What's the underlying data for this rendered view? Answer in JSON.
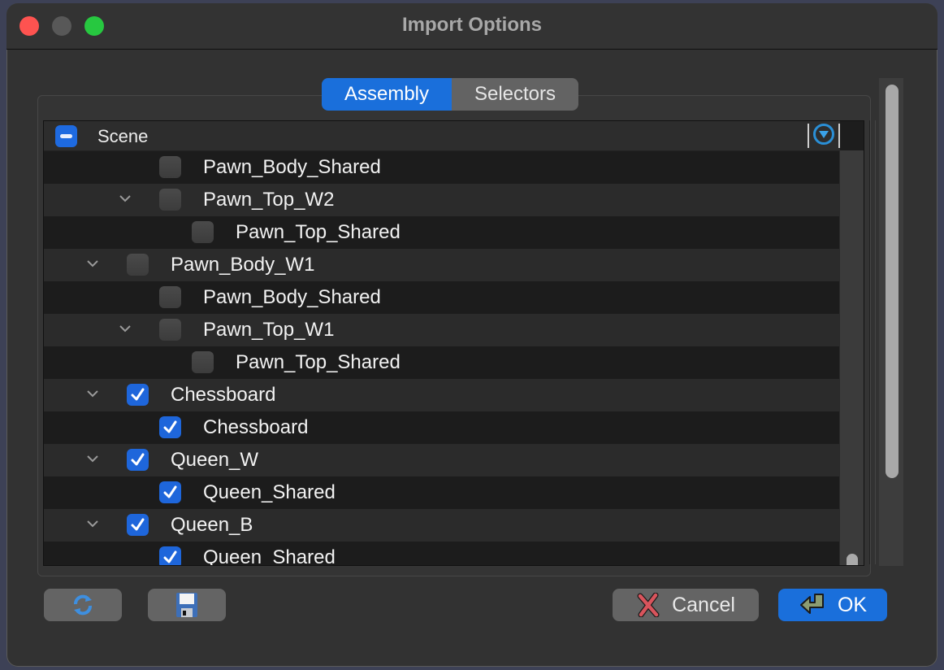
{
  "window": {
    "title": "Import Options"
  },
  "tabs": [
    {
      "label": "Assembly",
      "active": true
    },
    {
      "label": "Selectors",
      "active": false
    }
  ],
  "tree": {
    "header": {
      "label": "Scene",
      "checkbox_state": "partial",
      "menu_icon": "dropdown-circle-icon"
    },
    "rows": [
      {
        "label": "Pawn_Body_Shared",
        "depth": 2,
        "expandable": false,
        "checked": false
      },
      {
        "label": "Pawn_Top_W2",
        "depth": 2,
        "expandable": true,
        "checked": false
      },
      {
        "label": "Pawn_Top_Shared",
        "depth": 3,
        "expandable": false,
        "checked": false
      },
      {
        "label": "Pawn_Body_W1",
        "depth": 1,
        "expandable": true,
        "checked": false
      },
      {
        "label": "Pawn_Body_Shared",
        "depth": 2,
        "expandable": false,
        "checked": false
      },
      {
        "label": "Pawn_Top_W1",
        "depth": 2,
        "expandable": true,
        "checked": false
      },
      {
        "label": "Pawn_Top_Shared",
        "depth": 3,
        "expandable": false,
        "checked": false
      },
      {
        "label": "Chessboard",
        "depth": 1,
        "expandable": true,
        "checked": true
      },
      {
        "label": "Chessboard",
        "depth": 2,
        "expandable": false,
        "checked": true
      },
      {
        "label": "Queen_W",
        "depth": 1,
        "expandable": true,
        "checked": true
      },
      {
        "label": "Queen_Shared",
        "depth": 2,
        "expandable": false,
        "checked": true
      },
      {
        "label": "Queen_B",
        "depth": 1,
        "expandable": true,
        "checked": true
      },
      {
        "label": "Queen_Shared",
        "depth": 2,
        "expandable": false,
        "checked": true
      }
    ]
  },
  "buttons": {
    "refresh_icon": "refresh-icon",
    "save_icon": "floppy-disk-icon",
    "cancel_label": "Cancel",
    "cancel_icon": "red-x-icon",
    "ok_label": "OK",
    "ok_icon": "return-arrow-icon"
  },
  "colors": {
    "accent": "#1a6fdb",
    "window_bg": "#323232",
    "tree_bg": "#1d1d1d",
    "close": "#fe5350",
    "maximize": "#27c840"
  }
}
